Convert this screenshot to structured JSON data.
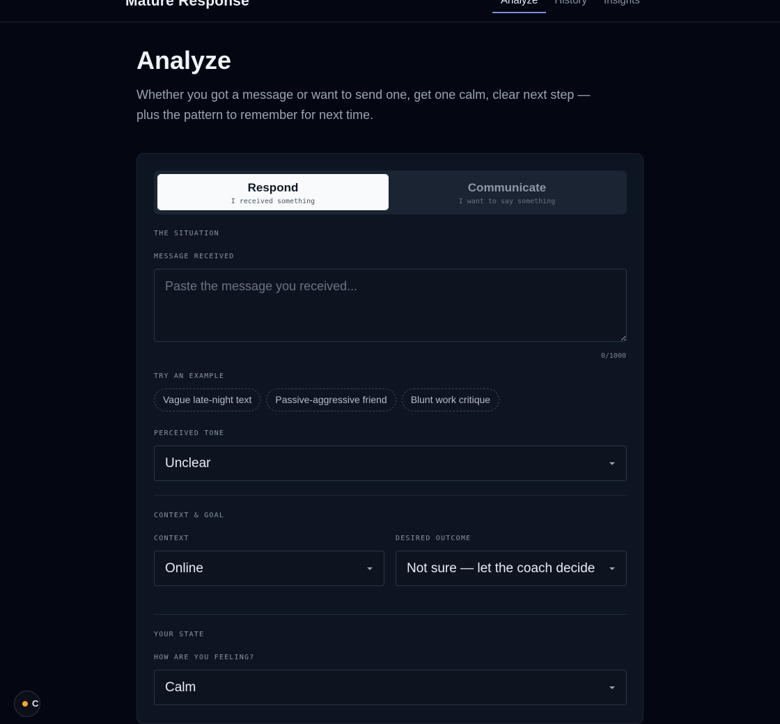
{
  "app": {
    "brand": "Mature Response",
    "nav": [
      {
        "label": "Analyze",
        "active": true
      },
      {
        "label": "History",
        "active": false
      },
      {
        "label": "Insights",
        "active": false
      }
    ]
  },
  "page": {
    "title": "Analyze",
    "description": "Whether you got a message or want to send one, get one calm, clear next step — plus the pattern to remember for next time."
  },
  "mode": {
    "respond": {
      "title": "Respond",
      "subtitle": "I received something"
    },
    "communicate": {
      "title": "Communicate",
      "subtitle": "I want to say something"
    },
    "selected": "respond"
  },
  "situation": {
    "section_label": "THE SITUATION",
    "message_label": "MESSAGE RECEIVED",
    "message_placeholder": "Paste the message you received...",
    "message_value": "",
    "counter": "0/1000",
    "examples_label": "TRY AN EXAMPLE",
    "examples": [
      "Vague late-night text",
      "Passive-aggressive friend",
      "Blunt work critique"
    ],
    "tone_label": "PERCEIVED TONE",
    "tone_value": "Unclear"
  },
  "context_goal": {
    "section_label": "CONTEXT & GOAL",
    "context_label": "CONTEXT",
    "context_value": "Online",
    "outcome_label": "DESIRED OUTCOME",
    "outcome_value": "Not sure — let the coach decide"
  },
  "state": {
    "section_label": "YOUR STATE",
    "feeling_label": "HOW ARE YOU FEELING?",
    "feeling_value": "Calm"
  },
  "status": {
    "letter": "C",
    "dot_color": "#f5a524"
  },
  "colors": {
    "background": "#040711",
    "card": "#0e1522",
    "accent": "#7c8fe3"
  }
}
